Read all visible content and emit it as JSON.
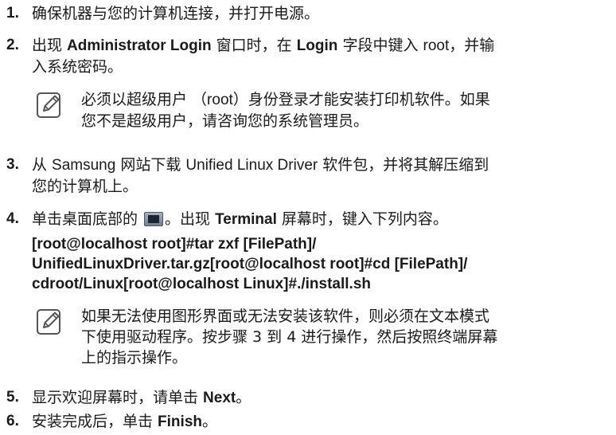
{
  "steps": [
    {
      "num": "1.",
      "text": "确保机器与您的计算机连接，并打开电源。"
    },
    {
      "num": "2.",
      "a": "出现 ",
      "b1": "Administrator Login",
      "c": " 窗口时，在 ",
      "b2": "Login",
      "d": " 字段中键入 ",
      "root": "root",
      "e": "，并输",
      "line2": "入系统密码。"
    },
    {
      "num": "3.",
      "a": "从 ",
      "samsung": "Samsung",
      "b": " 网站下载 ",
      "driver": "Unified Linux Driver",
      "c": " 软件包，并将其解压缩到",
      "line2": "您的计算机上。"
    },
    {
      "num": "4.",
      "a": "单击桌面底部的 ",
      "b": "。出现 ",
      "terminal": "Terminal",
      "c": " 屏幕时，键入下列内容。"
    },
    {
      "num": "5.",
      "a": "显示欢迎屏幕时，请单击 ",
      "next": "Next",
      "b": "。"
    },
    {
      "num": "6.",
      "a": "安装完成后，单击 ",
      "finish": "Finish",
      "b": "。"
    }
  ],
  "note1": {
    "a": "必须以超级用户 （",
    "root": "root",
    "b": "）身份登录才能安装打印机软件。如果",
    "line2": "您不是超级用户，请咨询您的系统管理员。"
  },
  "command": {
    "line1": "[root@localhost root]#tar zxf [FilePath]/",
    "line2": "UnifiedLinuxDriver.tar.gz[root@localhost root]#cd [FilePath]/",
    "line3": "cdroot/Linux[root@localhost Linux]#./install.sh"
  },
  "note2": {
    "line1": "如果无法使用图形界面或无法安装该软件，则必须在文本模式",
    "line2": "下使用驱动程序。按步骤 3 到 4 进行操作，然后按照终端屏幕",
    "line3": "上的指示操作。"
  },
  "icons": {
    "note": "note-pencil-icon",
    "terminal": "terminal-icon"
  }
}
